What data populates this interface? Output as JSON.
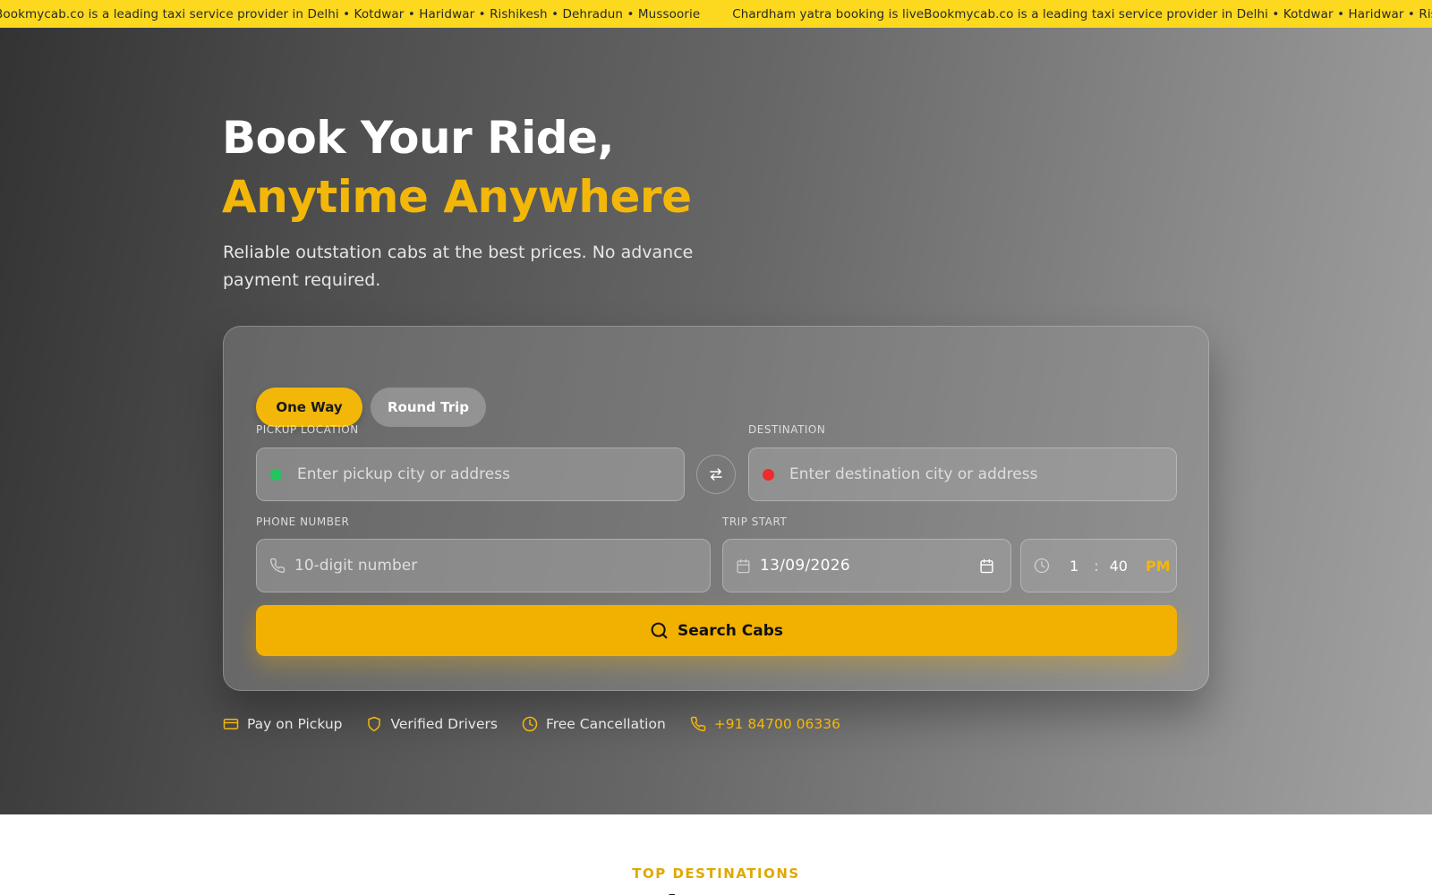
{
  "ticker": {
    "items": [
      "Bookmycab.co is a leading taxi service provider in Delhi • Kotdwar • Haridwar • Rishikesh • Dehradun • Mussoorie",
      "Chardham yatra booking is live",
      "Bookmycab.co is a leading taxi service provider in Delhi • Kotdwar • Haridwar • Rishikesh • Dehradun • Mussoorie"
    ]
  },
  "hero": {
    "title_line1": "Book Your Ride,",
    "title_line2": "Anytime Anywhere",
    "subtitle": "Reliable outstation cabs at the best prices. No advance payment required."
  },
  "booking": {
    "tabs": [
      {
        "label": "One Way",
        "active": true
      },
      {
        "label": "Round Trip",
        "active": false
      }
    ],
    "pickup": {
      "label": "PICKUP LOCATION",
      "placeholder": "Enter pickup city or address",
      "value": ""
    },
    "destination": {
      "label": "DESTINATION",
      "placeholder": "Enter destination city or address",
      "value": ""
    },
    "phone": {
      "label": "PHONE NUMBER",
      "placeholder": "10-digit number",
      "value": ""
    },
    "trip_start": {
      "label": "TRIP START",
      "date": "13/09/2026",
      "hour": "1",
      "separator": ":",
      "minute": "40",
      "ampm": "PM"
    },
    "search_label": "Search Cabs"
  },
  "features": [
    {
      "label": "Pay on Pickup",
      "icon": "credit-card-icon"
    },
    {
      "label": "Verified Drivers",
      "icon": "shield-icon"
    },
    {
      "label": "Free Cancellation",
      "icon": "clock-icon"
    },
    {
      "label": "+91 84700 06336",
      "icon": "phone-icon"
    }
  ],
  "section": {
    "eyebrow": "TOP DESTINATIONS",
    "title": "Popular Routes"
  },
  "colors": {
    "accent": "#f3b70a",
    "ticker_bg": "#fcd91e",
    "pickup_dot": "#22c55e",
    "destination_dot": "#ef2b2b"
  }
}
